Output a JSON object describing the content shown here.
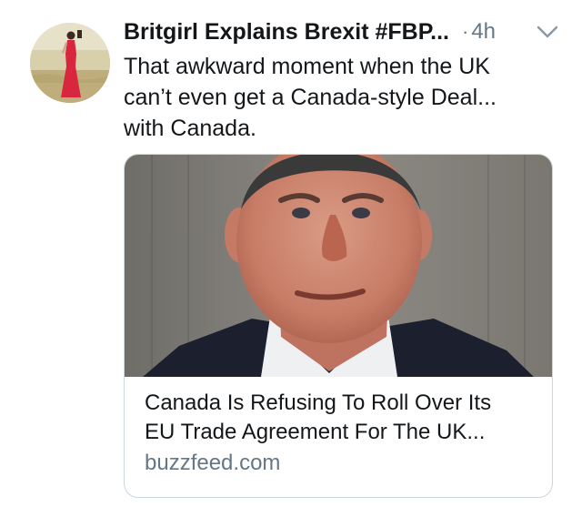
{
  "tweet": {
    "author_name": "Britgirl Explains Brexit #FBP...",
    "separator": "·",
    "timestamp": "4h",
    "text_lines": [
      "That awkward moment when the UK",
      "can’t even get a Canada-style Deal...",
      "with Canada."
    ],
    "card": {
      "title_lines": [
        "Canada Is Refusing To Roll Over Its",
        "EU Trade Agreement For The UK..."
      ],
      "domain": "buzzfeed.com"
    }
  },
  "icons": {
    "caret": "chevron-down-icon"
  },
  "colors": {
    "primary_text": "#14171a",
    "secondary_text": "#657786",
    "card_border": "#ccd6dd"
  }
}
